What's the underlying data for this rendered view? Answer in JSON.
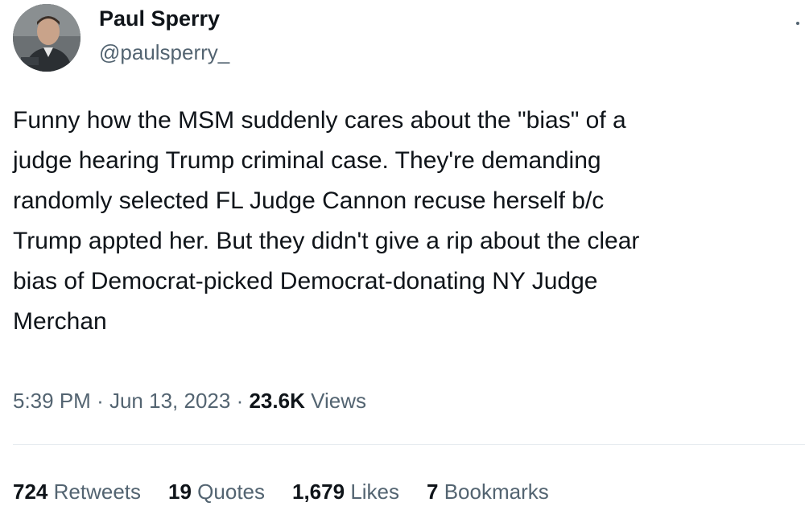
{
  "author": {
    "display_name": "Paul Sperry",
    "handle": "@paulsperry_",
    "avatar_icon": "profile-photo"
  },
  "tweet": {
    "text": "Funny how the MSM suddenly cares about the \"bias\" of a\njudge hearing Trump criminal case. They're demanding\nrandomly selected FL Judge Cannon recuse herself b/c\nTrump appted her. But they didn't give a rip about the clear\nbias of Democrat-picked Democrat-donating NY Judge\nMerchan",
    "time": "5:39 PM",
    "date": "Jun 13, 2023",
    "separator": "·",
    "views_count": "23.6K",
    "views_label": "Views"
  },
  "stats": [
    {
      "count": "724",
      "label": "Retweets"
    },
    {
      "count": "19",
      "label": "Quotes"
    },
    {
      "count": "1,679",
      "label": "Likes"
    },
    {
      "count": "7",
      "label": "Bookmarks"
    }
  ],
  "colors": {
    "text_primary": "#0f1419",
    "text_secondary": "#536471",
    "divider": "#e7ecf0"
  }
}
